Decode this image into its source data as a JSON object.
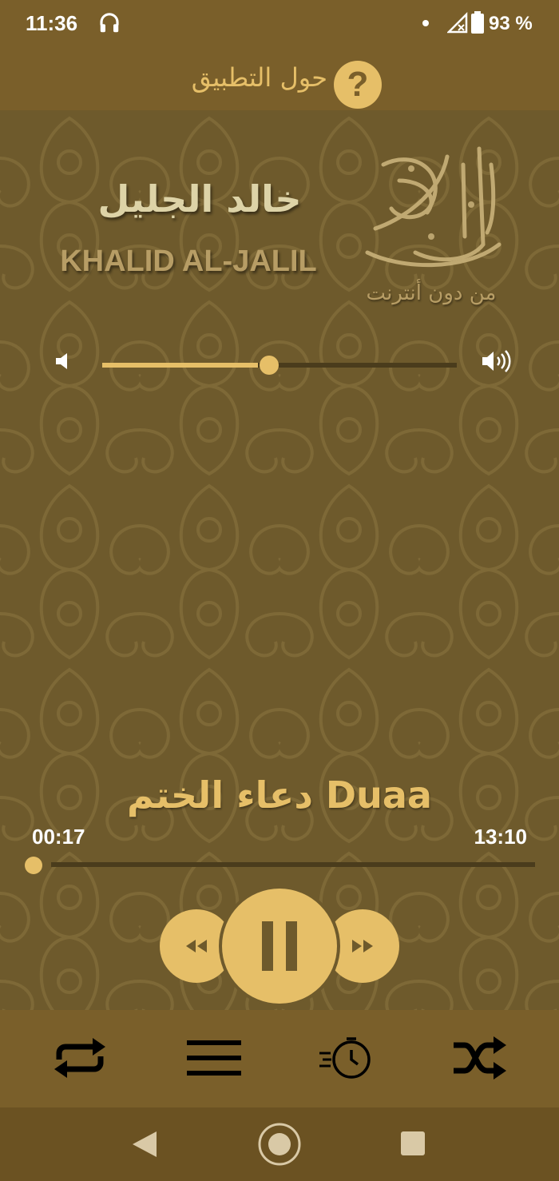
{
  "status_bar": {
    "time": "11:36",
    "battery": "93 %",
    "icons": [
      "headphones-icon",
      "signal-icon",
      "battery-icon"
    ]
  },
  "header": {
    "about_label": "حول التطبيق",
    "about_icon_glyph": "?"
  },
  "reciter": {
    "name_ar": "خالد الجليل",
    "name_en": "KHALID AL-JALIL"
  },
  "logo": {
    "subtitle": "من دون أنترنت"
  },
  "volume": {
    "level": 0.47
  },
  "player": {
    "track_title": "دعاء الختم Duaa",
    "current_time": "00:17",
    "total_time": "13:10",
    "progress": 0.0
  },
  "bottom_bar": {
    "icons": [
      "repeat-icon",
      "playlist-icon",
      "sleep-timer-icon",
      "shuffle-icon"
    ]
  },
  "colors": {
    "accent": "#e6bf68",
    "bar": "#7a5f2a",
    "background": "#6e5a2c"
  }
}
